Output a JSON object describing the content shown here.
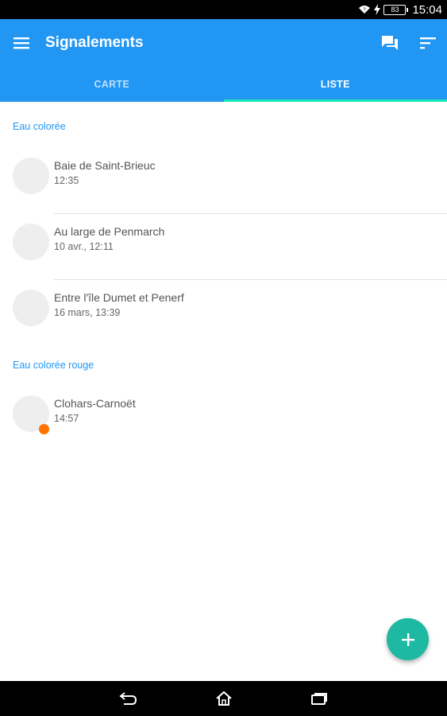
{
  "status_bar": {
    "battery": "83",
    "time": "15:04"
  },
  "app_bar": {
    "title": "Signalements",
    "color": "#2196F3",
    "accent": "#1DE9B6"
  },
  "tabs": [
    {
      "label": "CARTE",
      "active": false
    },
    {
      "label": "LISTE",
      "active": true
    }
  ],
  "sections": [
    {
      "header": "Eau colorée",
      "items": [
        {
          "title": "Baie de Saint-Brieuc",
          "subtitle": "12:35"
        },
        {
          "title": "Au large de Penmarch",
          "subtitle": "10 avr., 12:11"
        },
        {
          "title": "Entre l'île Dumet et Penerf",
          "subtitle": "16 mars, 13:39"
        }
      ]
    },
    {
      "header": "Eau colorée rouge",
      "items": [
        {
          "title": "Clohars-Carnoët",
          "subtitle": "14:57"
        }
      ]
    }
  ],
  "icons": {
    "menu": "menu-icon",
    "chat": "chat-icon",
    "sort": "sort-icon",
    "add": "add-icon",
    "back": "back-icon",
    "home": "home-icon",
    "recents": "recents-icon"
  },
  "colors": {
    "fab": "#1DB9A2",
    "status_dot": "#FF7300",
    "section_header": "#2196F3"
  }
}
